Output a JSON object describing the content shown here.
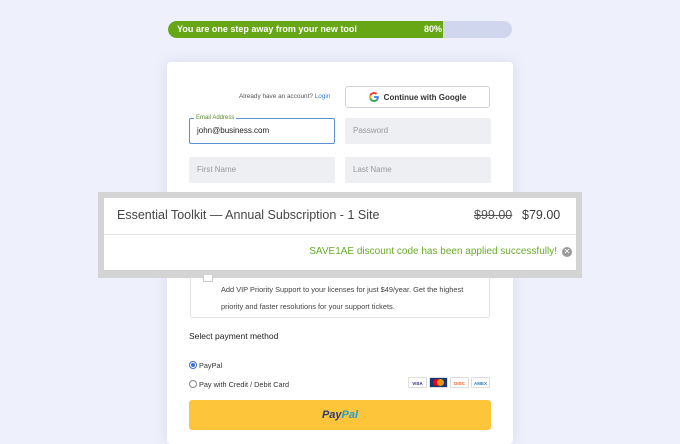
{
  "progress": {
    "message": "You are one step away from your new tool",
    "percent_label": "80%",
    "percent": 80
  },
  "login": {
    "prompt": "Already have an account?",
    "link": "Login",
    "google_button": "Continue with Google"
  },
  "form": {
    "email_label": "Email Address",
    "email_value": "john@business.com",
    "password_placeholder": "Password",
    "first_name_placeholder": "First Name",
    "last_name_placeholder": "Last Name"
  },
  "order": {
    "product": "Essential Toolkit — Annual Subscription - 1 Site",
    "old_price": "$99.00",
    "new_price": "$79.00",
    "discount_message": "SAVE1AE discount code has been applied successfully!"
  },
  "vip": {
    "text": "Add VIP Priority Support to your licenses for just $49/year. Get the highest priority and faster resolutions for your support tickets."
  },
  "payment": {
    "title": "Select payment method",
    "option_paypal": "PayPal",
    "option_card": "Pay with Credit / Debit Card",
    "selected": "PayPal",
    "card_icons": [
      "visa-icon",
      "mastercard-icon",
      "discover-icon",
      "amex-icon"
    ],
    "button_pay": "Pay",
    "button_pal": "Pal"
  },
  "colors": {
    "progress_fill": "#67a716",
    "discount_text": "#6aab2a",
    "paypal_button": "#fcc53a",
    "page_bg": "#eef0fb"
  }
}
